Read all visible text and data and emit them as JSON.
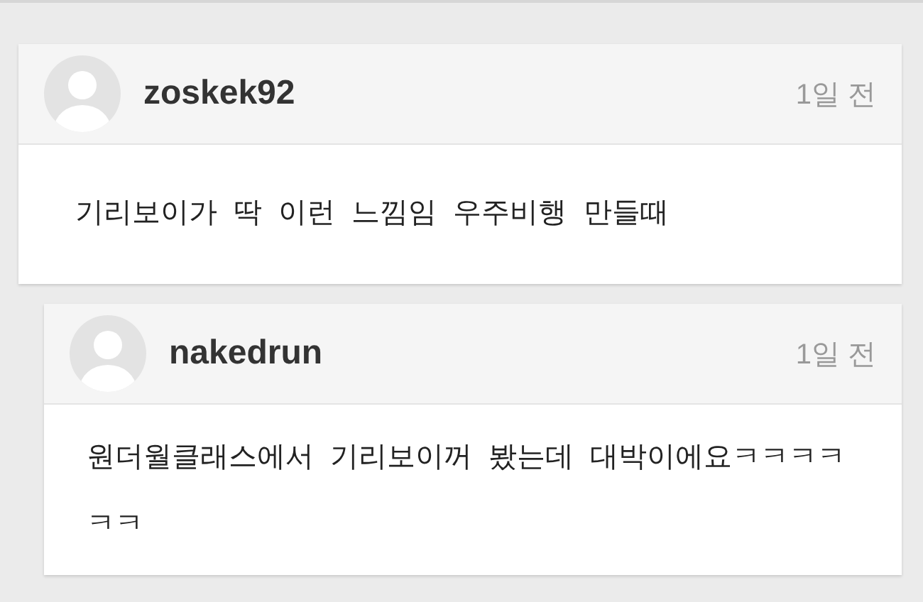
{
  "comments": [
    {
      "username": "zoskek92",
      "time": "1일 전",
      "text": "기리보이가 딱 이런 느낌임 우주비행 만들때",
      "reply": false
    },
    {
      "username": "nakedrun",
      "time": "1일 전",
      "text": "원더월클래스에서 기리보이꺼 봤는데 대박이에요ㅋㅋㅋㅋㅋㅋ",
      "reply": true
    }
  ]
}
